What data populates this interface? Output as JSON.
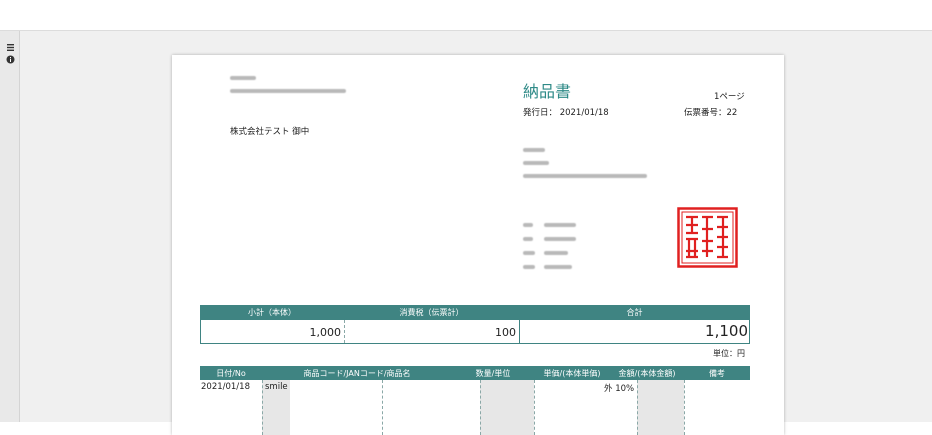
{
  "rail": {
    "icons": [
      "list-icon",
      "info-icon"
    ]
  },
  "doc": {
    "title": "納品書",
    "page": "1ページ",
    "issue_date": "発行日： 2021/01/18",
    "slip_no": "伝票番号：22",
    "customer": "株式会社テスト 御中",
    "totals": {
      "headers": [
        "小計（本体）",
        "消費税（伝票計）",
        "合計"
      ],
      "subtotal": "1,000",
      "tax": "100",
      "total": "1,100",
      "unit": "単位：円"
    },
    "items": {
      "headers": [
        "日付/No",
        "商品コード/JANコード/商品名",
        "数量/単位",
        "単価/(本体単価)",
        "金額/(本体金額)",
        "備考"
      ],
      "row1": {
        "date": "2021/01/18",
        "name": "smile",
        "tax_note": "外 10%"
      }
    }
  },
  "colors": {
    "accent": "#2e8a87",
    "header_bg": "#3f8482",
    "seal": "#e02020"
  }
}
